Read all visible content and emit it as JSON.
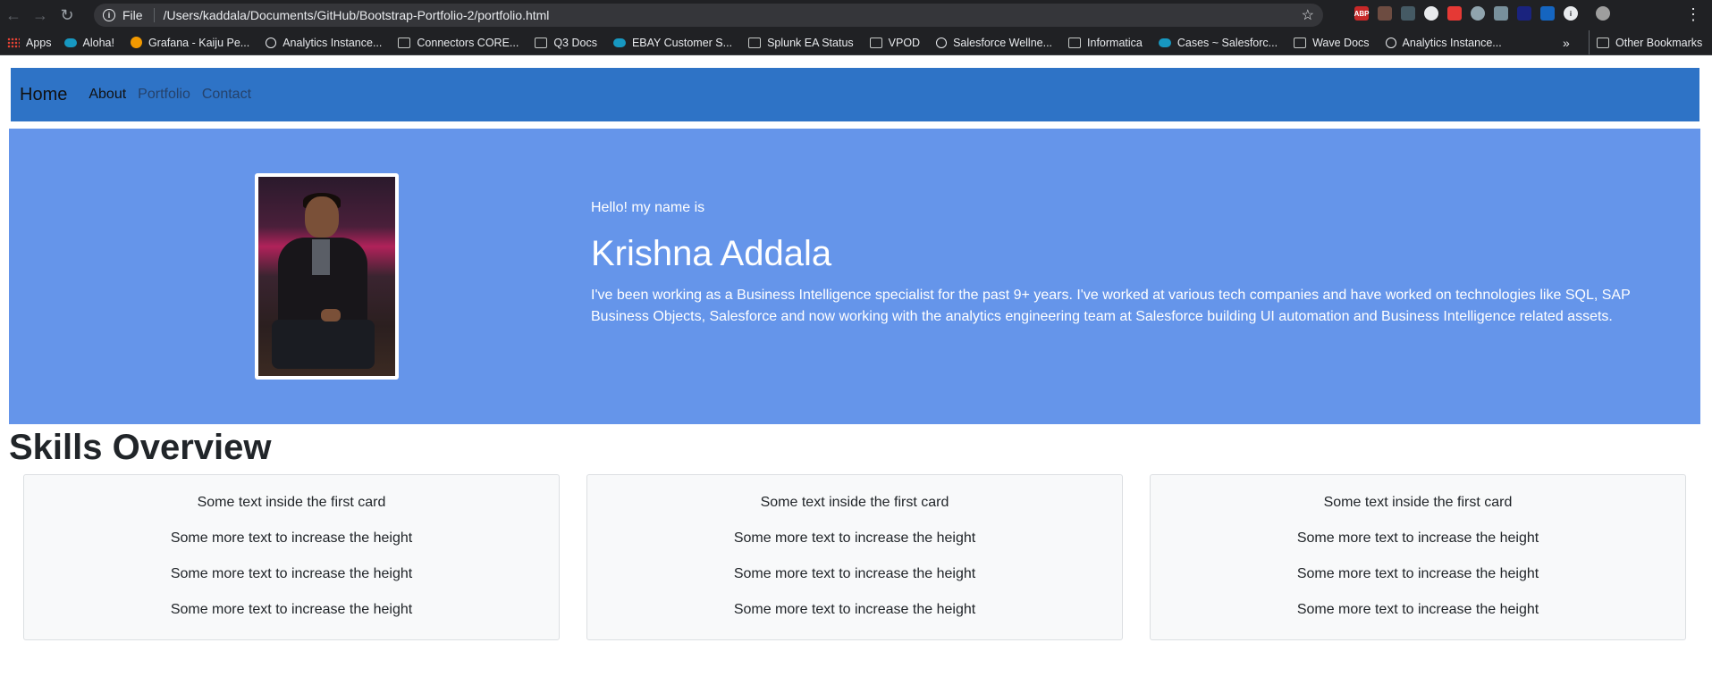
{
  "browser": {
    "url_scheme": "File",
    "url": "/Users/kaddala/Documents/GitHub/Bootstrap-Portfolio-2/portfolio.html",
    "bookmarks": [
      {
        "label": "Apps",
        "icon": "apps-grid-icon"
      },
      {
        "label": "Aloha!",
        "icon": "salesforce-cloud-icon"
      },
      {
        "label": "Grafana - Kaiju Pe...",
        "icon": "grafana-icon"
      },
      {
        "label": "Analytics Instance...",
        "icon": "globe-icon"
      },
      {
        "label": "Connectors CORE...",
        "icon": "folder-icon"
      },
      {
        "label": "Q3 Docs",
        "icon": "folder-icon"
      },
      {
        "label": "EBAY Customer S...",
        "icon": "salesforce-cloud-icon"
      },
      {
        "label": "Splunk EA Status",
        "icon": "folder-icon"
      },
      {
        "label": "VPOD",
        "icon": "folder-icon"
      },
      {
        "label": "Salesforce Wellne...",
        "icon": "globe-icon"
      },
      {
        "label": "Informatica",
        "icon": "folder-icon"
      },
      {
        "label": "Cases ~ Salesforc...",
        "icon": "salesforce-cloud-icon"
      },
      {
        "label": "Wave Docs",
        "icon": "folder-icon"
      },
      {
        "label": "Analytics Instance...",
        "icon": "globe-icon"
      }
    ],
    "more_label": "»",
    "other_bookmarks": "Other Bookmarks"
  },
  "navbar": {
    "brand": "Home",
    "links": [
      "About",
      "Portfolio",
      "Contact"
    ],
    "color": "#2e73c6"
  },
  "hero": {
    "greeting": "Hello! my name is",
    "name": "Krishna Addala",
    "bio": "I've been working as a Business Intelligence specialist for the past 9+ years. I've worked at various tech companies and have worked on technologies like SQL, SAP Business Objects, Salesforce and now working with the analytics engineering team at Salesforce building UI automation and Business Intelligence related assets.",
    "color": "#6595ea"
  },
  "skills": {
    "title": "Skills Overview",
    "cards": [
      {
        "lines": [
          "Some text inside the first card",
          "Some more text to increase the height",
          "Some more text to increase the height",
          "Some more text to increase the height"
        ]
      },
      {
        "lines": [
          "Some text inside the first card",
          "Some more text to increase the height",
          "Some more text to increase the height",
          "Some more text to increase the height"
        ]
      },
      {
        "lines": [
          "Some text inside the first card",
          "Some more text to increase the height",
          "Some more text to increase the height",
          "Some more text to increase the height"
        ]
      }
    ]
  }
}
